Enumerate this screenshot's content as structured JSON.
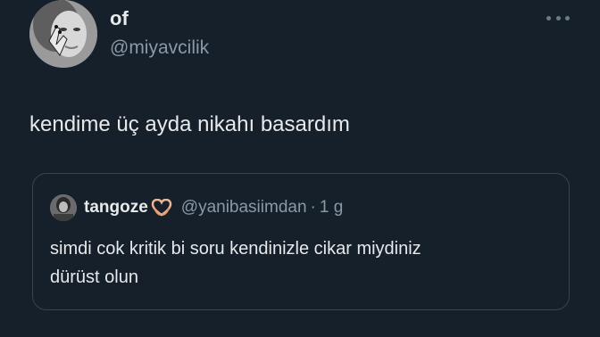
{
  "tweet": {
    "author": {
      "display_name": "of",
      "handle": "@miyavcilik",
      "avatar_icon": "user-avatar"
    },
    "more_icon": "more-horizontal-icon",
    "text": "kendime üç ayda nikahı basardım"
  },
  "quoted_tweet": {
    "author": {
      "display_name": "tangoze",
      "emoji_icon": "heart-hands-icon",
      "handle": "@yanibasiimdan",
      "separator": "·",
      "time": "1 g"
    },
    "text_line1": "simdi cok kritik bi soru kendinizle cikar miydiniz",
    "text_line2": "dürüst olun"
  },
  "colors": {
    "background": "#15202b",
    "text_primary": "#e7e9ea",
    "text_secondary": "#8b98a5",
    "border": "#3a4450"
  }
}
